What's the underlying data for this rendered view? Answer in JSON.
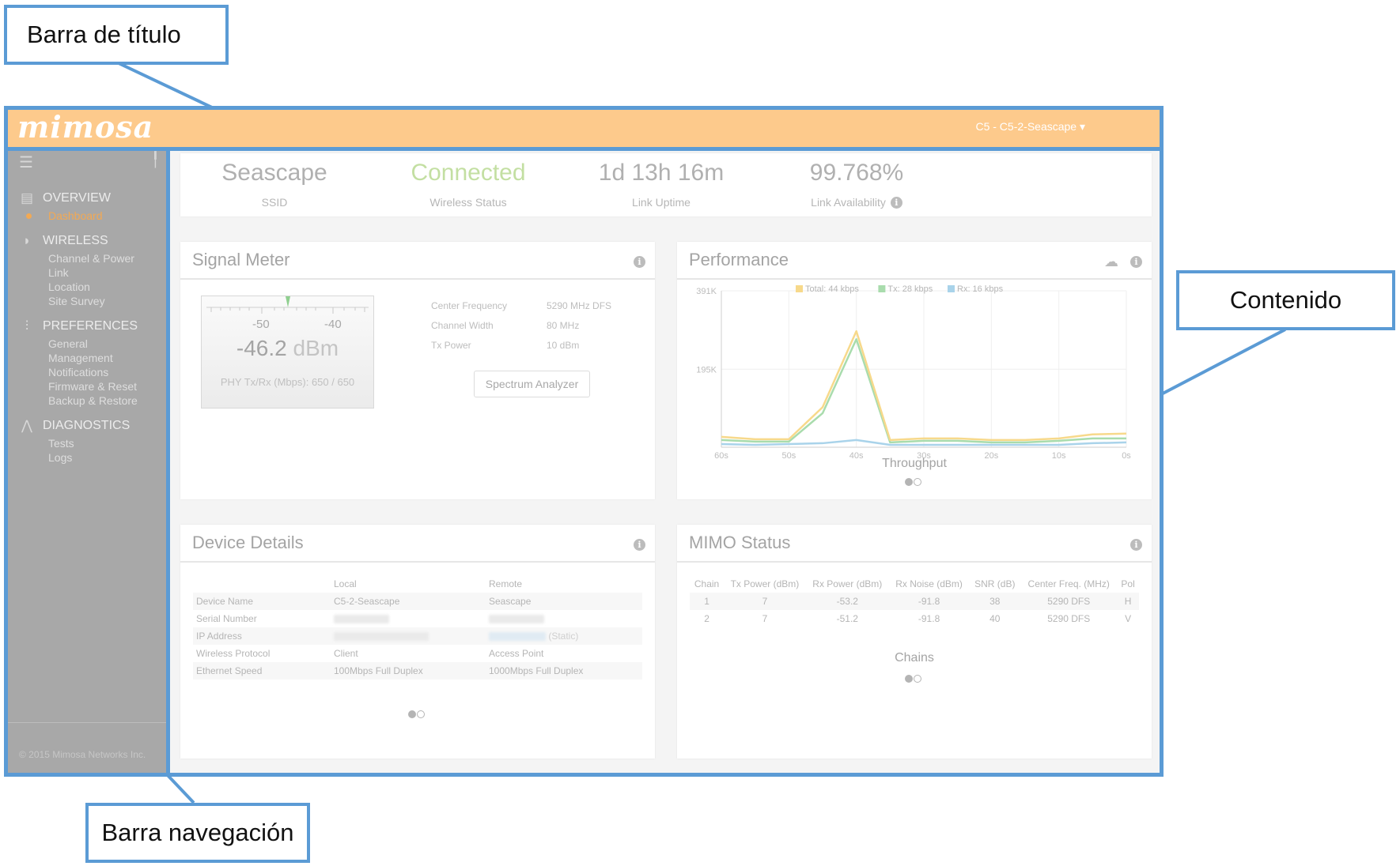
{
  "annotations": {
    "title_bar": "Barra de título",
    "content": "Contenido",
    "nav_bar": "Barra navegación"
  },
  "header": {
    "logo": "mimosa",
    "device_selector": "C5 - C5-2-Seascape ▾"
  },
  "sidebar": {
    "sections": [
      {
        "label": "OVERVIEW",
        "icon": "list-icon",
        "items": [
          {
            "label": "Dashboard",
            "active": true
          }
        ]
      },
      {
        "label": "WIRELESS",
        "icon": "wifi-icon",
        "items": [
          {
            "label": "Channel & Power"
          },
          {
            "label": "Link"
          },
          {
            "label": "Location"
          },
          {
            "label": "Site Survey"
          }
        ]
      },
      {
        "label": "PREFERENCES",
        "icon": "sliders-icon",
        "items": [
          {
            "label": "General"
          },
          {
            "label": "Management"
          },
          {
            "label": "Notifications"
          },
          {
            "label": "Firmware & Reset"
          },
          {
            "label": "Backup & Restore"
          }
        ]
      },
      {
        "label": "DIAGNOSTICS",
        "icon": "pulse-icon",
        "items": [
          {
            "label": "Tests"
          },
          {
            "label": "Logs"
          }
        ]
      }
    ],
    "footer": "© 2015 Mimosa Networks Inc."
  },
  "summary": {
    "ssid": {
      "value": "Seascape",
      "label": "SSID"
    },
    "status": {
      "value": "Connected",
      "label": "Wireless Status"
    },
    "uptime": {
      "value": "1d 13h 16m",
      "label": "Link Uptime"
    },
    "availability": {
      "value": "99.768%",
      "label": "Link Availability"
    }
  },
  "signal_meter": {
    "title": "Signal Meter",
    "scale_left": "-50",
    "scale_right": "-40",
    "value": "-46.2",
    "unit": "dBm",
    "phy_label": "PHY Tx/Rx (Mbps):",
    "phy_value": "650  /  650",
    "rows": [
      {
        "key": "Center Frequency",
        "value": "5290 MHz DFS"
      },
      {
        "key": "Channel Width",
        "value": "80 MHz"
      },
      {
        "key": "Tx Power",
        "value": "10 dBm"
      }
    ],
    "button": "Spectrum Analyzer"
  },
  "performance": {
    "title": "Performance",
    "caption": "Throughput"
  },
  "device_details": {
    "title": "Device Details",
    "headers": [
      "",
      "Local",
      "Remote"
    ],
    "rows": [
      {
        "label": "Device Name",
        "local": "C5-2-Seascape",
        "remote": "Seascape"
      },
      {
        "label": "Serial Number",
        "local": "",
        "remote": ""
      },
      {
        "label": "IP Address",
        "local": "",
        "remote": "(Static)"
      },
      {
        "label": "Wireless Protocol",
        "local": "Client",
        "remote": "Access Point"
      },
      {
        "label": "Ethernet Speed",
        "local": "100Mbps Full Duplex",
        "remote": "1000Mbps Full Duplex"
      }
    ]
  },
  "mimo": {
    "title": "MIMO Status",
    "headers": [
      "Chain",
      "Tx Power (dBm)",
      "Rx Power (dBm)",
      "Rx Noise (dBm)",
      "SNR (dB)",
      "Center Freq. (MHz)",
      "Pol"
    ],
    "rows": [
      [
        "1",
        "7",
        "-53.2",
        "-91.8",
        "38",
        "5290 DFS",
        "H"
      ],
      [
        "2",
        "7",
        "-51.2",
        "-91.8",
        "40",
        "5290 DFS",
        "V"
      ]
    ],
    "caption": "Chains"
  },
  "chart_data": {
    "type": "line",
    "title": "",
    "xlabel": "Throughput",
    "ylabel": "",
    "x": [
      60,
      55,
      50,
      45,
      40,
      35,
      30,
      25,
      20,
      15,
      10,
      5,
      0
    ],
    "x_tick_labels": [
      "60s",
      "50s",
      "40s",
      "30s",
      "20s",
      "10s",
      "0s"
    ],
    "y_tick_labels": [
      "391K",
      "195K"
    ],
    "ylim": [
      0,
      391
    ],
    "grid": true,
    "legend_position": "top-center",
    "series": [
      {
        "name": "Total: 44 kbps",
        "color": "#f7d98b",
        "values": [
          26,
          20,
          20,
          100,
          290,
          18,
          22,
          22,
          18,
          18,
          22,
          32,
          34
        ]
      },
      {
        "name": "Tx: 28 kbps",
        "color": "#a9dcad",
        "values": [
          18,
          14,
          14,
          85,
          270,
          12,
          16,
          16,
          12,
          12,
          16,
          22,
          22
        ]
      },
      {
        "name": "Rx: 16 kbps",
        "color": "#a9d3ea",
        "values": [
          8,
          6,
          8,
          10,
          18,
          6,
          6,
          6,
          6,
          6,
          6,
          10,
          12
        ]
      }
    ]
  }
}
